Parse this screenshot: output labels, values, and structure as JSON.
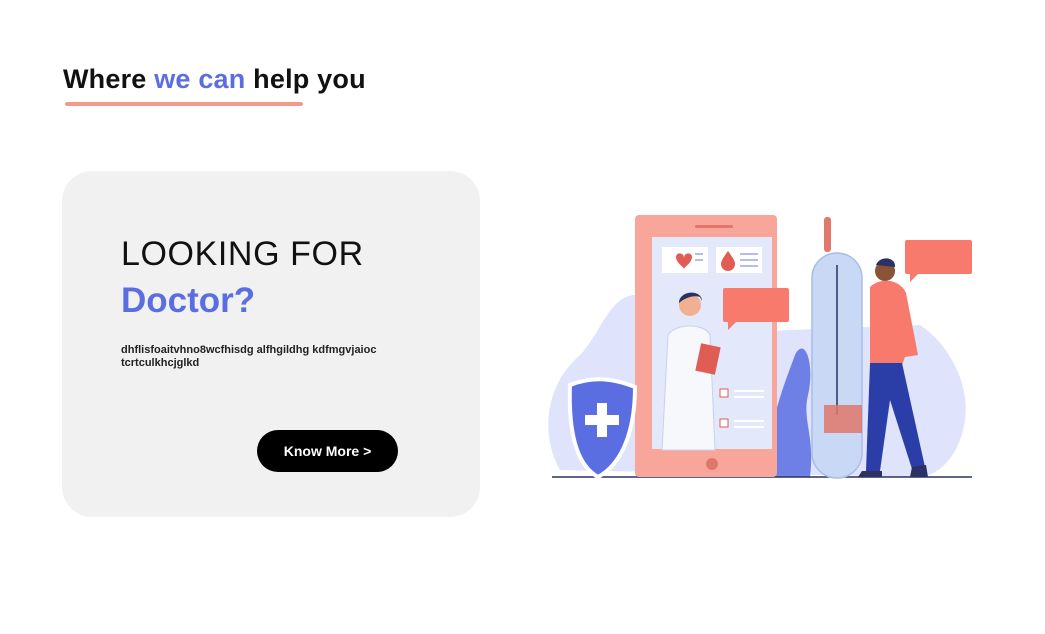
{
  "section": {
    "heading_part1": "Where ",
    "heading_accent": "we can",
    "heading_part2": " help you"
  },
  "card": {
    "title": "LOOKING FOR",
    "subtitle": "Doctor?",
    "description": "dhflisfoaitvhno8wcfhisdg alfhgildhg kdfmgvjaioc tcrtculkhcjglkd",
    "button_label": "Know More >"
  },
  "colors": {
    "accent": "#5b6ee1",
    "underline": "#f29a8b",
    "card_bg": "#f1f1f1",
    "button_bg": "#000000"
  },
  "illustration": {
    "icons": [
      "shield-plus-icon",
      "heart-icon",
      "blood-drop-icon",
      "thermometer-icon",
      "chat-bubble-icon",
      "checkbox-icon"
    ]
  }
}
